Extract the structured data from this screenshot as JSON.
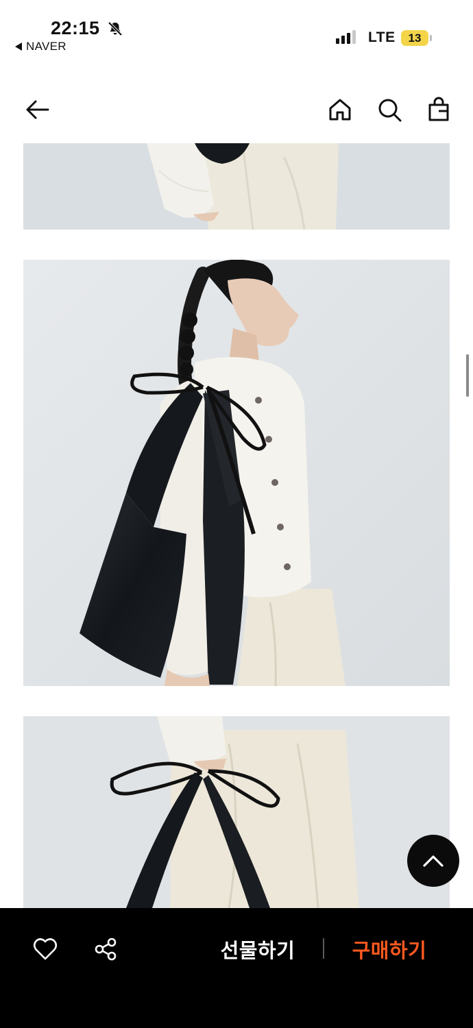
{
  "status_bar": {
    "time": "22:15",
    "back_app_label": "NAVER",
    "network": "LTE",
    "battery": "13",
    "icons": [
      "bell-muted-icon",
      "signal-icon",
      "battery-icon"
    ]
  },
  "header": {
    "icons": [
      "back-arrow-icon",
      "home-icon",
      "search-icon",
      "shopping-bag-icon"
    ]
  },
  "content": {
    "images": [
      "product-photo-knit-cardigan-cream-pants-cropped",
      "product-photo-model-black-leather-hobo-bag-bow-strap",
      "product-photo-model-holding-black-bag-bow-strap"
    ]
  },
  "floating": {
    "icon": "chevron-up-icon"
  },
  "bottom_bar": {
    "gift_label": "선물하기",
    "buy_label": "구매하기",
    "icons": [
      "heart-icon",
      "share-icon"
    ],
    "colors": {
      "background": "#000000",
      "buy": "#ff5a1f",
      "gift": "#ffffff"
    }
  }
}
